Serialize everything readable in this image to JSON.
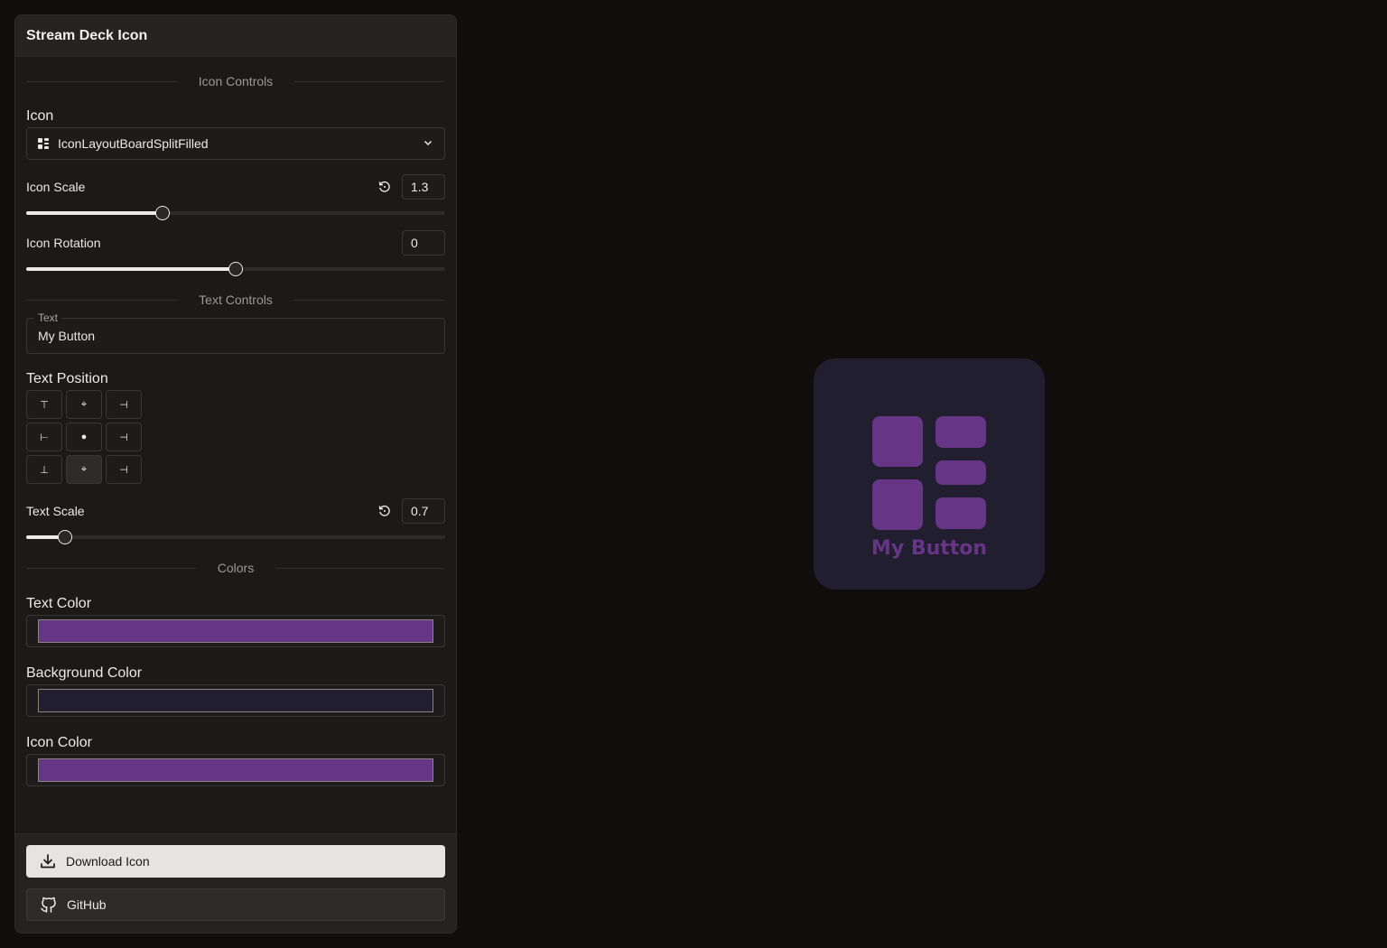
{
  "panel": {
    "title": "Stream Deck Icon"
  },
  "sections": {
    "icon_controls": "Icon Controls",
    "text_controls": "Text Controls",
    "colors": "Colors"
  },
  "icon": {
    "label": "Icon",
    "selected": "IconLayoutBoardSplitFilled",
    "icon_name": "layout-board-split-icon"
  },
  "icon_scale": {
    "label": "Icon Scale",
    "value": "1.3",
    "fraction": 0.325
  },
  "icon_rotation": {
    "label": "Icon Rotation",
    "value": "0",
    "fraction": 0.5
  },
  "text_field": {
    "legend": "Text",
    "value": "My Button"
  },
  "text_position": {
    "label": "Text Position",
    "buttons": [
      {
        "name": "top-left",
        "glyph": "⊤"
      },
      {
        "name": "top-center",
        "glyph": "⌖"
      },
      {
        "name": "top-right",
        "glyph": "⊣"
      },
      {
        "name": "middle-left",
        "glyph": "⊢"
      },
      {
        "name": "middle-center",
        "glyph": "●"
      },
      {
        "name": "middle-right",
        "glyph": "⊣"
      },
      {
        "name": "bottom-left",
        "glyph": "⊥"
      },
      {
        "name": "bottom-center",
        "glyph": "⌖"
      },
      {
        "name": "bottom-right",
        "glyph": "⊣"
      }
    ],
    "selected": "bottom-center"
  },
  "text_scale": {
    "label": "Text Scale",
    "value": "0.7",
    "fraction": 0.093
  },
  "colors": {
    "text": {
      "label": "Text Color",
      "value": "#663586"
    },
    "background": {
      "label": "Background Color",
      "value": "#211e30"
    },
    "icon": {
      "label": "Icon Color",
      "value": "#663586"
    }
  },
  "footer": {
    "download_label": "Download Icon",
    "github_label": "GitHub"
  },
  "preview": {
    "text": "My Button",
    "text_color": "#663586",
    "bg_color": "#211e30",
    "icon_color": "#663586"
  }
}
